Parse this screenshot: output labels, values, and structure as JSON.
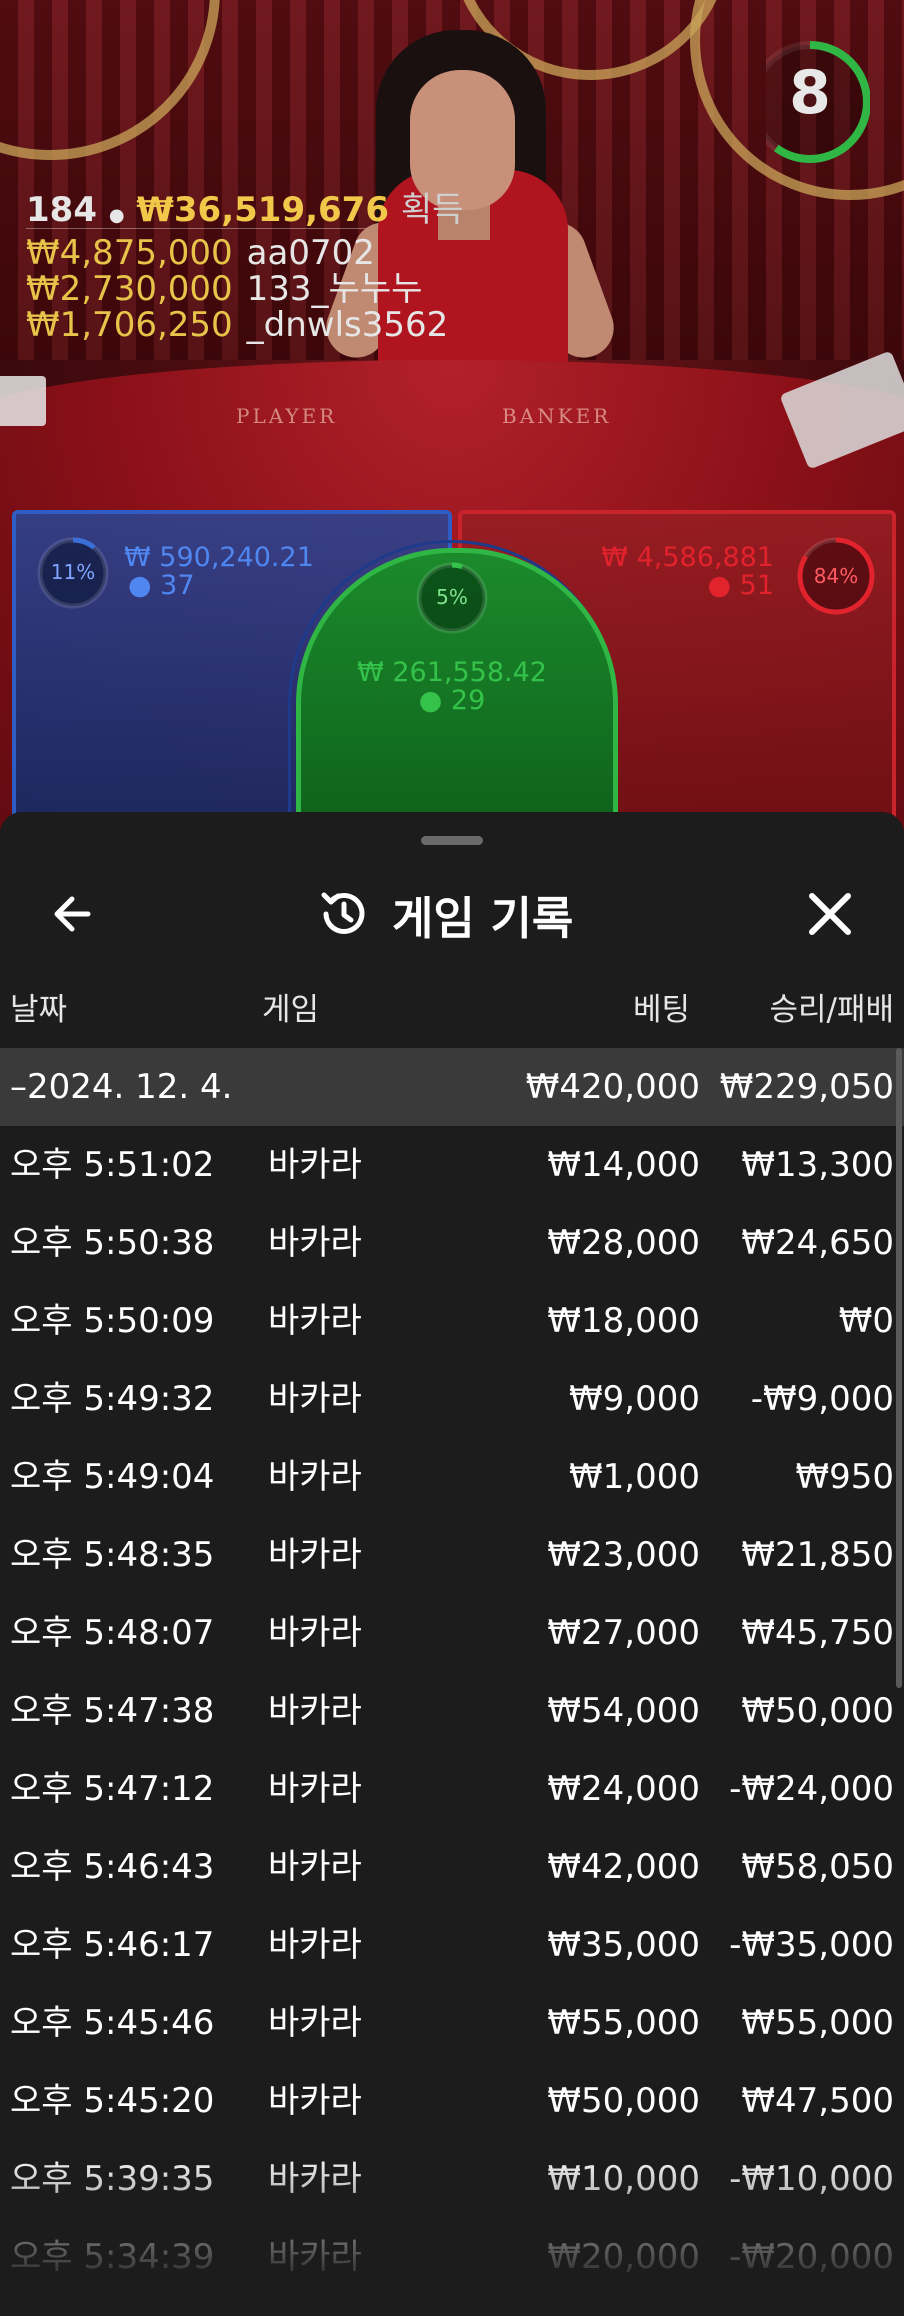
{
  "game": {
    "timer": "8",
    "table_labels": {
      "player": "PLAYER",
      "banker": "BANKER"
    },
    "winners": {
      "player_count": "184",
      "total_won": "₩36,519,676",
      "won_label": "획득",
      "entries": [
        {
          "amount": "₩4,875,000",
          "name": "aa0702"
        },
        {
          "amount": "₩2,730,000",
          "name": "133_누누누"
        },
        {
          "amount": "₩1,706,250",
          "name": "_dnwls3562"
        }
      ]
    },
    "zones": {
      "player": {
        "percent": "11%",
        "amount": "₩ 590,240.21",
        "players": "37",
        "color": "#3b6fd8"
      },
      "tie": {
        "percent": "5%",
        "amount": "₩ 261,558.42",
        "players": "29",
        "color": "#35c24a"
      },
      "banker": {
        "percent": "84%",
        "amount": "₩ 4,586,881",
        "players": "51",
        "color": "#e2222c"
      }
    }
  },
  "sheet": {
    "title": "게임 기록",
    "columns": {
      "date": "날짜",
      "game": "게임",
      "bet": "베팅",
      "result": "승리/패배"
    },
    "summary": {
      "date": "–2024. 12. 4.",
      "bet": "₩420,000",
      "result": "₩229,050"
    },
    "rows": [
      {
        "time": "오후 5:51:02",
        "game": "바카라",
        "bet": "₩14,000",
        "result": "₩13,300"
      },
      {
        "time": "오후 5:50:38",
        "game": "바카라",
        "bet": "₩28,000",
        "result": "₩24,650"
      },
      {
        "time": "오후 5:50:09",
        "game": "바카라",
        "bet": "₩18,000",
        "result": "₩0"
      },
      {
        "time": "오후 5:49:32",
        "game": "바카라",
        "bet": "₩9,000",
        "result": "-₩9,000"
      },
      {
        "time": "오후 5:49:04",
        "game": "바카라",
        "bet": "₩1,000",
        "result": "₩950"
      },
      {
        "time": "오후 5:48:35",
        "game": "바카라",
        "bet": "₩23,000",
        "result": "₩21,850"
      },
      {
        "time": "오후 5:48:07",
        "game": "바카라",
        "bet": "₩27,000",
        "result": "₩45,750"
      },
      {
        "time": "오후 5:47:38",
        "game": "바카라",
        "bet": "₩54,000",
        "result": "₩50,000"
      },
      {
        "time": "오후 5:47:12",
        "game": "바카라",
        "bet": "₩24,000",
        "result": "-₩24,000"
      },
      {
        "time": "오후 5:46:43",
        "game": "바카라",
        "bet": "₩42,000",
        "result": "₩58,050"
      },
      {
        "time": "오후 5:46:17",
        "game": "바카라",
        "bet": "₩35,000",
        "result": "-₩35,000"
      },
      {
        "time": "오후 5:45:46",
        "game": "바카라",
        "bet": "₩55,000",
        "result": "₩55,000"
      },
      {
        "time": "오후 5:45:20",
        "game": "바카라",
        "bet": "₩50,000",
        "result": "₩47,500"
      },
      {
        "time": "오후 5:39:35",
        "game": "바카라",
        "bet": "₩10,000",
        "result": "-₩10,000"
      },
      {
        "time": "오후 5:34:39",
        "game": "바카라",
        "bet": "₩20,000",
        "result": "-₩20,000"
      }
    ]
  }
}
